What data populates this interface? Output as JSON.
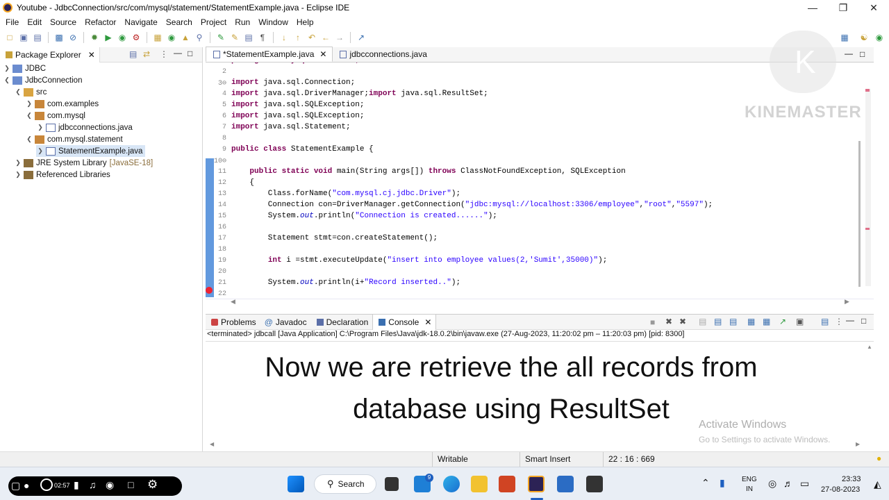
{
  "window": {
    "title": "Youtube - JdbcConnection/src/com/mysql/statement/StatementExample.java - Eclipse IDE"
  },
  "menu": [
    "File",
    "Edit",
    "Source",
    "Refactor",
    "Navigate",
    "Search",
    "Project",
    "Run",
    "Window",
    "Help"
  ],
  "package_explorer": {
    "tab": "Package Explorer",
    "items": [
      {
        "label": "JDBC",
        "extra": ""
      },
      {
        "label": "JdbcConnection",
        "extra": ""
      },
      {
        "label": "src",
        "extra": ""
      },
      {
        "label": "com.examples",
        "extra": ""
      },
      {
        "label": "com.mysql",
        "extra": ""
      },
      {
        "label": "jdbcconnections.java",
        "extra": ""
      },
      {
        "label": "com.mysql.statement",
        "extra": ""
      },
      {
        "label": "StatementExample.java",
        "extra": ""
      },
      {
        "label": "JRE System Library",
        "extra": "[JavaSE-18]"
      },
      {
        "label": "Referenced Libraries",
        "extra": ""
      }
    ]
  },
  "editor": {
    "tabs": [
      {
        "label": "*StatementExample.java",
        "active": true
      },
      {
        "label": "jdbcconnections.java",
        "active": false
      }
    ],
    "lines": [
      {
        "n": "2",
        "text": ""
      },
      {
        "n": "3⊖",
        "text": "import java.sql.Connection;"
      },
      {
        "n": "4",
        "text": "import java.sql.DriverManager;import java.sql.ResultSet;"
      },
      {
        "n": "5",
        "text": "import java.sql.SQLException;"
      },
      {
        "n": "6",
        "text": "import java.sql.SQLException;"
      },
      {
        "n": "7",
        "text": "import java.sql.Statement;"
      },
      {
        "n": "8",
        "text": ""
      },
      {
        "n": "9",
        "text": "public class StatementExample {"
      },
      {
        "n": "10⊖",
        "text": ""
      },
      {
        "n": "11",
        "text": "    public static void main(String args[]) throws ClassNotFoundException, SQLException"
      },
      {
        "n": "12",
        "text": "    {"
      },
      {
        "n": "13",
        "text": "        Class.forName(\"com.mysql.cj.jdbc.Driver\");"
      },
      {
        "n": "14",
        "text": "        Connection con=DriverManager.getConnection(\"jdbc:mysql://localhost:3306/employee\",\"root\",\"5597\");"
      },
      {
        "n": "15",
        "text": "        System.out.println(\"Connection is created......\");"
      },
      {
        "n": "16",
        "text": ""
      },
      {
        "n": "17",
        "text": "        Statement stmt=con.createStatement();"
      },
      {
        "n": "18",
        "text": ""
      },
      {
        "n": "19",
        "text": "        int i =stmt.executeUpdate(\"insert into employee values(2,'Sumit',35000)\");"
      },
      {
        "n": "20",
        "text": ""
      },
      {
        "n": "21",
        "text": "        System.out.println(i+\"Record inserted..\");"
      },
      {
        "n": "22",
        "text": ""
      }
    ]
  },
  "console": {
    "tabs": [
      "Problems",
      "Javadoc",
      "Declaration",
      "Console"
    ],
    "status": "<terminated> jdbcall [Java Application] C:\\Program Files\\Java\\jdk-18.0.2\\bin\\javaw.exe  (27-Aug-2023, 11:20:02 pm – 11:20:03 pm) [pid: 8300]",
    "caption_line1": "Now we are retrieve the all records from",
    "caption_line2": "database using ResultSet"
  },
  "watermark": {
    "text": "KINEMASTER"
  },
  "activate": {
    "line1": "Activate Windows",
    "line2": "Go to Settings to activate Windows."
  },
  "statusbar": {
    "writable": "Writable",
    "mode": "Smart Insert",
    "pos": "22 : 16 : 669"
  },
  "taskbar": {
    "search": "Search",
    "lang1": "ENG",
    "lang2": "IN",
    "time": "23:33",
    "date": "27-08-2023",
    "badge": "9",
    "rec_time": "02:57"
  },
  "colors": {
    "keyword": "#7f0055",
    "string": "#2a00ff",
    "field": "#0000c0"
  }
}
